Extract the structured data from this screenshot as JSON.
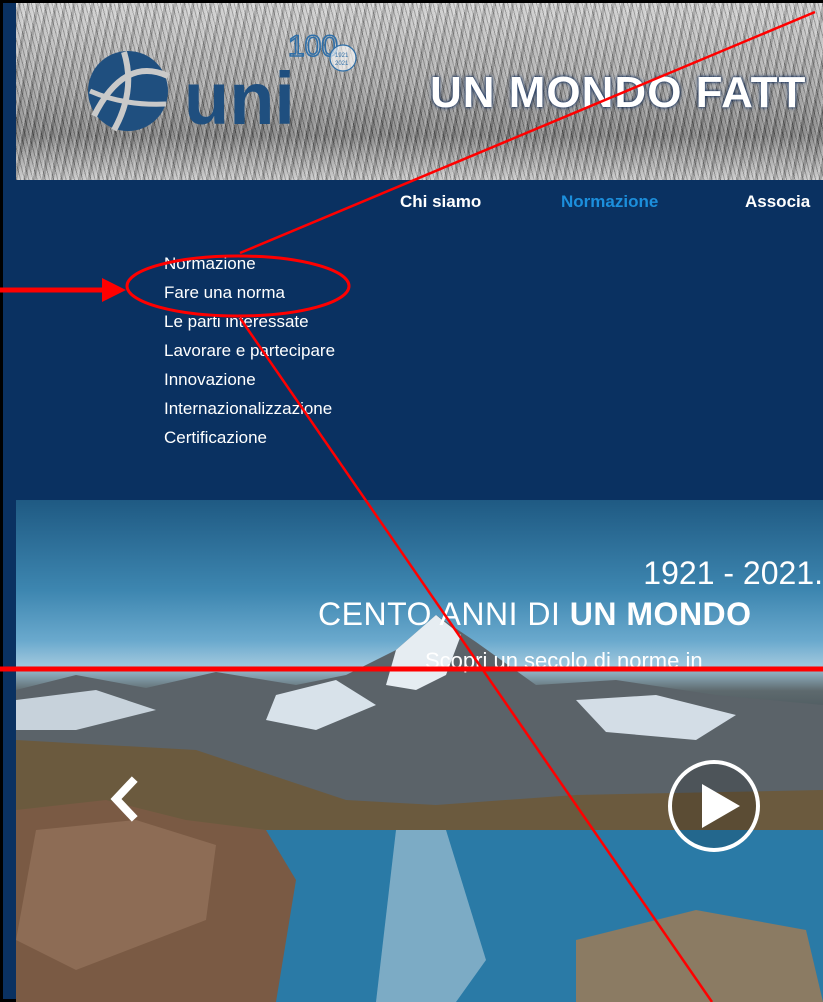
{
  "header": {
    "logo_text": "uni",
    "badge_number": "100",
    "badge_years": [
      "1921",
      "2021"
    ],
    "slogan": "UN MONDO FATT"
  },
  "nav": {
    "items": [
      {
        "label": "Chi siamo",
        "active": false
      },
      {
        "label": "Normazione",
        "active": true
      },
      {
        "label": "Associa",
        "active": false
      }
    ],
    "submenu": [
      "Normazione",
      "Fare una norma",
      "Le parti interessate",
      "Lavorare e partecipare",
      "Innovazione",
      "Internazionalizzazione",
      "Certificazione"
    ]
  },
  "hero": {
    "line1": "1921 - 2021.",
    "line2_prefix": "CENTO ANNI DI ",
    "line2_bold": "UN MONDO",
    "line3": "Scopri un secolo di norme in"
  },
  "icons": {
    "prev": "chevron-left-icon",
    "play": "play-icon"
  },
  "colors": {
    "nav_background": "#0a3161",
    "active_nav": "#1c8fdc",
    "logo_blue": "#1f4f7f",
    "annotation_red": "#ff0000"
  }
}
